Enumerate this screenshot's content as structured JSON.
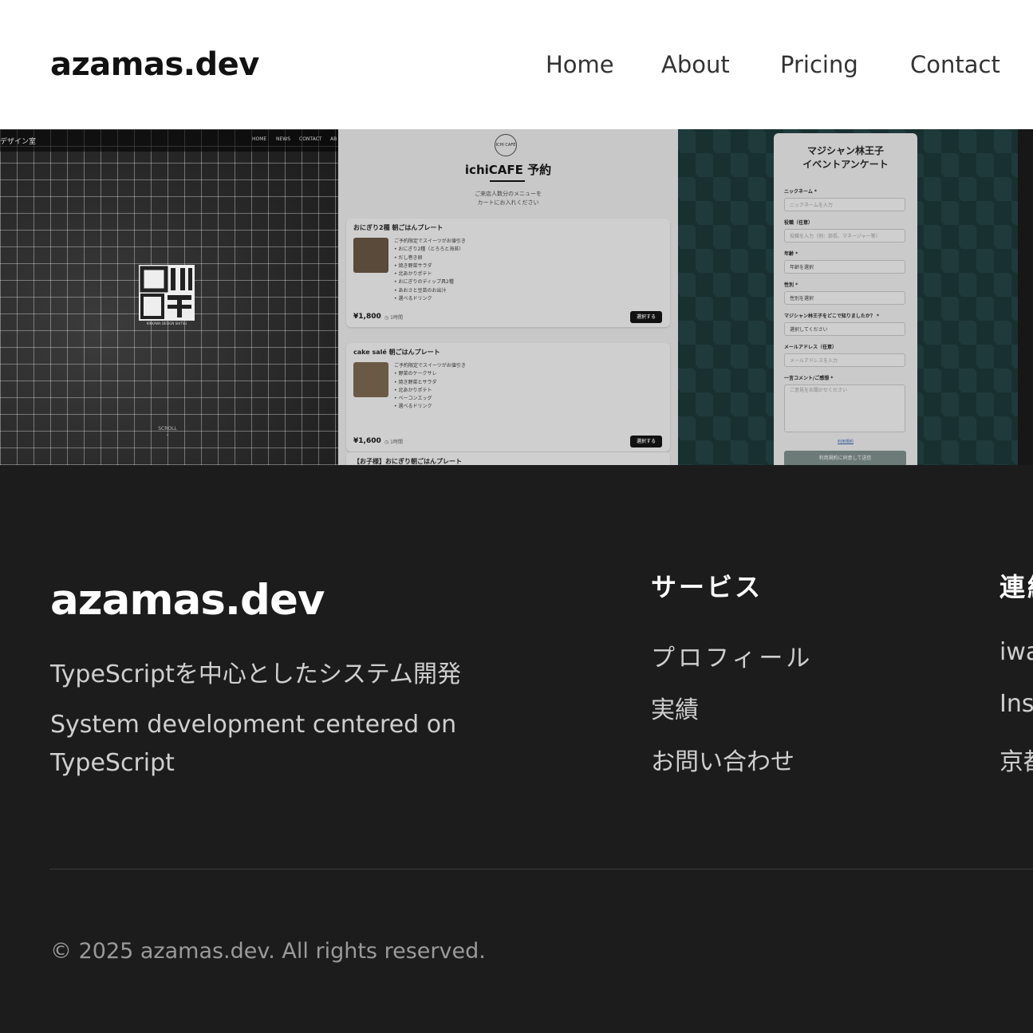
{
  "header": {
    "logo": "azamas.dev",
    "nav": [
      "Home",
      "About",
      "Pricing",
      "Contact"
    ]
  },
  "gallery": {
    "tile1": {
      "site_title": "デザイン室",
      "menu": [
        "HOME",
        "NEWS",
        "CONTACT",
        "AB"
      ],
      "logo_text": "吉川デザイン室",
      "logo_sub": "KIKKAWA DESIGN SHITSU",
      "scroll": "SCROLL"
    },
    "tile2": {
      "logo": "ICHI CAFE",
      "title": "ichiCAFE 予約",
      "subtitle_line1": "ご来店人数分のメニューを",
      "subtitle_line2": "カートにお入れください",
      "cards": [
        {
          "title": "おにぎり2種 朝ごはんプレート",
          "desc": "ご予約限定でスイーツがお値引き\n• おにぎり2種（とろろと海苔）\n• だし巻き卵\n• 焼き野菜サラダ\n• 北あかりポテト\n• おにぎりのディップ具2種\n• あおさと豆苗のお出汁\n• 選べるドリンク",
          "price": "¥1,800",
          "time": "1時間",
          "button": "選択する"
        },
        {
          "title": "cake salé 朝ごはんプレート",
          "desc": "ご予約限定でスイーツがお値引き\n• 野菜のケークサレ\n• 焼き野菜とサラダ\n• 北あかりポテト\n• ベーコンエッグ\n• 選べるドリンク",
          "price": "¥1,600",
          "time": "1時間",
          "button": "選択する"
        },
        {
          "title": "【お子様】おにぎり朝ごはんプレート"
        }
      ]
    },
    "tile3": {
      "title_line1": "マジシャン林王子",
      "title_line2": "イベントアンケート",
      "fields": [
        {
          "label": "ニックネーム *",
          "placeholder": "ニックネームを入力"
        },
        {
          "label": "役職（任意）",
          "placeholder": "役職を入力（例：部長、マネージャー等）"
        },
        {
          "label": "年齢 *",
          "placeholder": "年齢を選択"
        },
        {
          "label": "性別 *",
          "placeholder": "性別を選択"
        },
        {
          "label": "マジシャン林王子をどこで知りましたか？ *",
          "placeholder": "選択してください"
        },
        {
          "label": "メールアドレス（任意）",
          "placeholder": "メールアドレスを入力"
        },
        {
          "label": "一言コメント/ご感想 *",
          "placeholder": "ご意見をお聞かせください"
        }
      ],
      "terms_link": "利用規約",
      "submit": "利用規約に同意して送信"
    }
  },
  "footer": {
    "logo": "azamas.dev",
    "tagline_ja": "TypeScriptを中心としたシステム開発",
    "tagline_en": "System development centered on TypeScript",
    "services_heading": "サービス",
    "services": [
      "プロフィール",
      "実績",
      "お問い合わせ"
    ],
    "contact_heading": "連絡",
    "contact_items": [
      "iwa",
      "Inst",
      "京都"
    ],
    "copyright": "© 2025 azamas.dev. All rights reserved."
  }
}
